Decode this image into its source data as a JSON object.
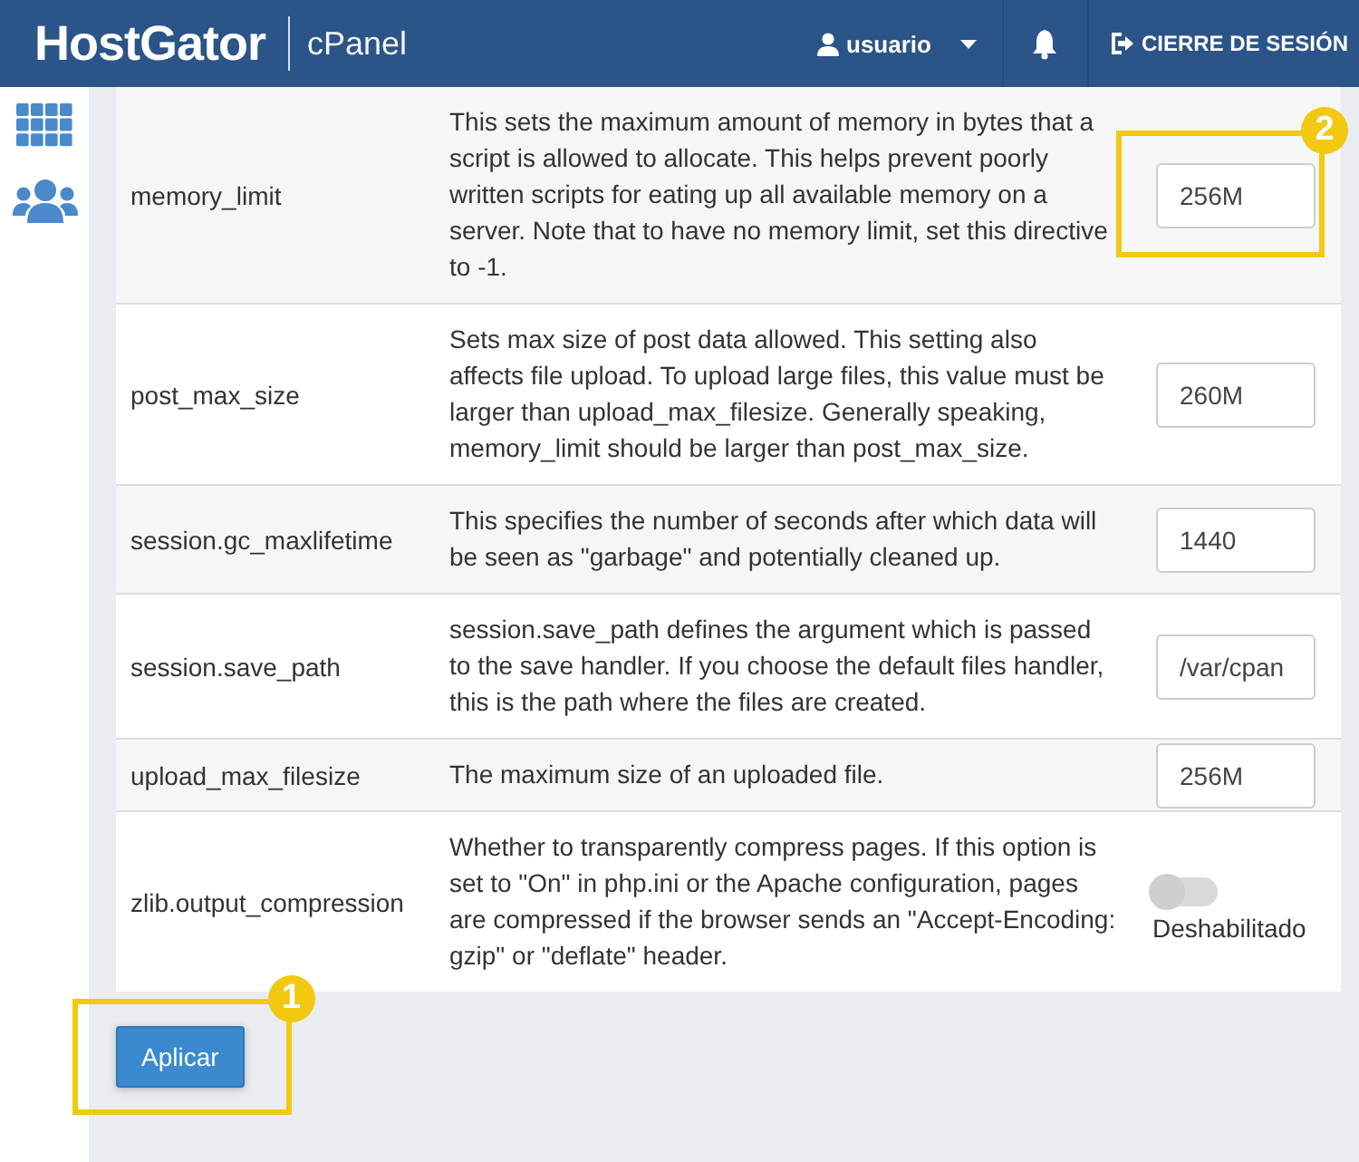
{
  "header": {
    "logo": "HostGator",
    "product": "cPanel",
    "user": "usuario",
    "logout": "CIERRE DE SESIÓN"
  },
  "settings": [
    {
      "name": "memory_limit",
      "description": "This sets the maximum amount of memory in bytes that a script is allowed to allocate. This helps prevent poorly written scripts for eating up all available memory on a server. Note that to have no memory limit, set this directive to -1.",
      "kind": "input",
      "value": "256M",
      "callout": "2"
    },
    {
      "name": "post_max_size",
      "description": "Sets max size of post data allowed. This setting also affects file upload. To upload large files, this value must be larger than upload_max_filesize. Generally speaking, memory_limit should be larger than post_max_size.",
      "kind": "input",
      "value": "260M"
    },
    {
      "name": "session.gc_maxlifetime",
      "description": "This specifies the number of seconds after which data will be seen as \"garbage\" and potentially cleaned up.",
      "kind": "input",
      "value": "1440"
    },
    {
      "name": "session.save_path",
      "description": "session.save_path defines the argument which is passed to the save handler. If you choose the default files handler, this is the path where the files are created.",
      "kind": "input",
      "value": "/var/cpan"
    },
    {
      "name": "upload_max_filesize",
      "description": "The maximum size of an uploaded file.",
      "kind": "input",
      "value": "256M"
    },
    {
      "name": "zlib.output_compression",
      "description": "Whether to transparently compress pages. If this option is set to \"On\" in php.ini or the Apache configuration, pages are compressed if the browser sends an \"Accept-Encoding: gzip\" or \"deflate\" header.",
      "kind": "toggle",
      "on": false,
      "label": "Deshabilitado"
    }
  ],
  "apply_button": {
    "label": "Aplicar",
    "callout": "1"
  }
}
